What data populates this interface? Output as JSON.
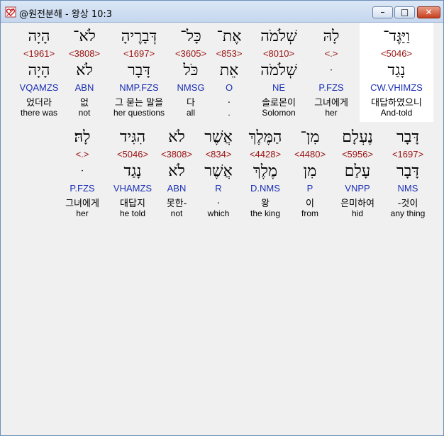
{
  "window": {
    "title": "@원전분해 - 왕상 10:3",
    "minimize_glyph": "–",
    "maximize_glyph": "□",
    "close_glyph": "✕",
    "icon": "heart-app-icon"
  },
  "rows": [
    {
      "words": [
        {
          "hebrew": "וַיַּגֶּד־",
          "strong": "<5046>",
          "lemma": "נָגַד",
          "parse": "CW.VHIMZS",
          "korean": "대답하였으니",
          "english": "And-told",
          "selected": true
        },
        {
          "hebrew": "לָהּ",
          "strong": "<.>",
          "lemma": "ּ",
          "parse": "P.FZS",
          "korean": "그녀에게",
          "english": "her"
        },
        {
          "hebrew": "שְׁלֹמֹה",
          "strong": "<8010>",
          "lemma": "שְׁלֹמֹה",
          "parse": "NE",
          "korean": "솔로몬이",
          "english": "Solomon"
        },
        {
          "hebrew": "אֶת־",
          "strong": "<853>",
          "lemma": "אֵת",
          "parse": "O",
          "korean": ".",
          "english": "."
        },
        {
          "hebrew": "כָּל־",
          "strong": "<3605>",
          "lemma": "כֹּל",
          "parse": "NMSG",
          "korean": "다",
          "english": "all"
        },
        {
          "hebrew": "דְּבָרֶיהָ",
          "strong": "<1697>",
          "lemma": "דָּבָר",
          "parse": "NMP.FZS",
          "korean": "그 묻는 말을",
          "english": "her questions"
        },
        {
          "hebrew": "לֹא־",
          "strong": "<3808>",
          "lemma": "לֹא",
          "parse": "ABN",
          "korean": "없",
          "english": "not"
        },
        {
          "hebrew": "הָיָה",
          "strong": "<1961>",
          "lemma": "הָיָה",
          "parse": "VQAMZS",
          "korean": "었더라",
          "english": "there was"
        }
      ]
    },
    {
      "words": [
        {
          "hebrew": "דָּבָר",
          "strong": "<1697>",
          "lemma": "דָּבָר",
          "parse": "NMS",
          "korean": "-것이",
          "english": "any thing"
        },
        {
          "hebrew": "נֶעְלָם",
          "strong": "<5956>",
          "lemma": "עָלַם",
          "parse": "VNPP",
          "korean": "은미하여",
          "english": "hid"
        },
        {
          "hebrew": "מִן־",
          "strong": "<4480>",
          "lemma": "מִן",
          "parse": "P",
          "korean": "이",
          "english": "from"
        },
        {
          "hebrew": "הַמֶּלֶךְ",
          "strong": "<4428>",
          "lemma": "מֶלֶךְ",
          "parse": "D.NMS",
          "korean": "왕",
          "english": "the king"
        },
        {
          "hebrew": "אֲשֶׁר",
          "strong": "<834>",
          "lemma": "אֲשֶׁר",
          "parse": "R",
          "korean": ".",
          "english": "which"
        },
        {
          "hebrew": "לֹא",
          "strong": "<3808>",
          "lemma": "לֹא",
          "parse": "ABN",
          "korean": "못한-",
          "english": "not"
        },
        {
          "hebrew": "הִגִּיד",
          "strong": "<5046>",
          "lemma": "נָגַד",
          "parse": "VHAMZS",
          "korean": "대답지",
          "english": "he told"
        },
        {
          "hebrew": "לָהּ׃",
          "strong": "<.>",
          "lemma": "ּ",
          "parse": "P.FZS",
          "korean": "그녀에게",
          "english": "her"
        }
      ]
    }
  ]
}
